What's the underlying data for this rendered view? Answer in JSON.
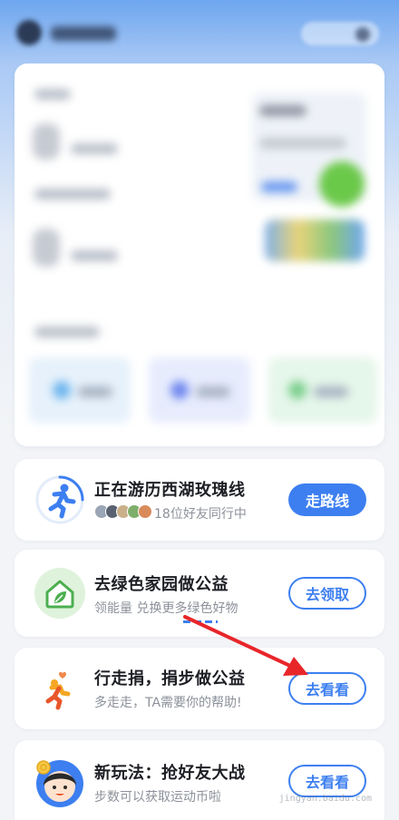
{
  "cards": [
    {
      "title": "正在游历西湖玫瑰线",
      "subtitle": "18位好友同行中",
      "button": "走路线",
      "icon": "running-route-icon"
    },
    {
      "title": "去绿色家园做公益",
      "subtitle": "领能量 兑换更多绿色好物",
      "button": "去领取",
      "icon": "green-home-leaf-icon"
    },
    {
      "title": "行走捐，捐步做公益",
      "subtitle": "多走走，TA需要你的帮助!",
      "button": "去看看",
      "icon": "walking-donate-icon"
    },
    {
      "title": "新玩法：抢好友大战",
      "subtitle": "步数可以获取运动币啦",
      "button": "去看看",
      "icon": "girl-coin-avatar-icon"
    }
  ],
  "watermark": "jingyan.baidu.com",
  "colors": {
    "accent": "#3d7ff0",
    "annotation_arrow": "#e8262a",
    "green": "#4caf50"
  }
}
